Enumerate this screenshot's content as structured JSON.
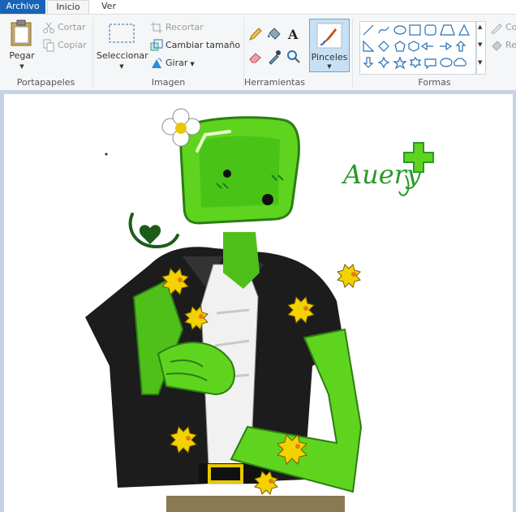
{
  "tabs": {
    "file": "Archivo",
    "home": "Inicio",
    "view": "Ver"
  },
  "clipboard": {
    "paste": "Pegar",
    "cut": "Cortar",
    "copy": "Copiar",
    "label": "Portapapeles"
  },
  "image": {
    "select": "Seleccionar",
    "crop": "Recortar",
    "resize": "Cambiar tamaño",
    "rotate": "Girar",
    "label": "Imagen"
  },
  "tools": {
    "label": "Herramientas"
  },
  "brushes": {
    "label": "Pinceles"
  },
  "shapes": {
    "label": "Formas",
    "outline_partial": "Co",
    "fill_partial": "Re"
  },
  "artwork": {
    "signature": "Auery"
  },
  "colors": {
    "file_tab": "#1a64b8",
    "ribbon": "#f5f6f7",
    "workspace": "#c6d3e6",
    "brush_active": "#c7e0f4",
    "slime_green": "#5fd41e",
    "jacket": "#1c1c1c"
  }
}
